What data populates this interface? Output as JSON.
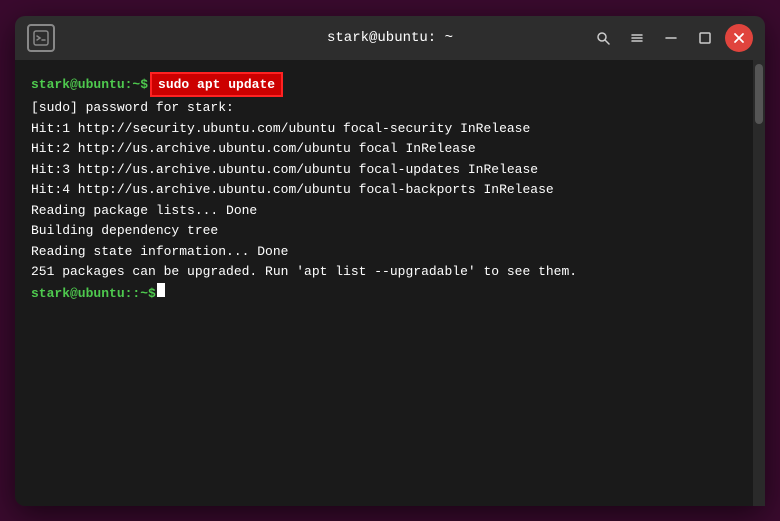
{
  "titlebar": {
    "title": "stark@ubuntu: ~",
    "icon_label": "T",
    "btn_close_label": "✕",
    "btn_minimize_label": "–",
    "btn_maximize_label": "□"
  },
  "terminal": {
    "prompt1": "stark@ubuntu:",
    "prompt1_symbol": "~$",
    "command_highlighted": " sudo apt update",
    "line_password": "[sudo] password for stark:",
    "line_hit1": "Hit:1 http://security.ubuntu.com/ubuntu focal-security InRelease",
    "line_hit2": "Hit:2 http://us.archive.ubuntu.com/ubuntu focal InRelease",
    "line_hit3": "Hit:3 http://us.archive.ubuntu.com/ubuntu focal-updates InRelease",
    "line_hit4": "Hit:4 http://us.archive.ubuntu.com/ubuntu focal-backports InRelease",
    "line_reading": "Reading package lists... Done",
    "line_building": "Building dependency tree",
    "line_reading_state": "Reading state information... Done",
    "line_packages": "251 packages can be upgraded. Run 'apt list --upgradable' to see them.",
    "prompt2": "stark@ubuntu:",
    "prompt2_symbol": "~$"
  }
}
